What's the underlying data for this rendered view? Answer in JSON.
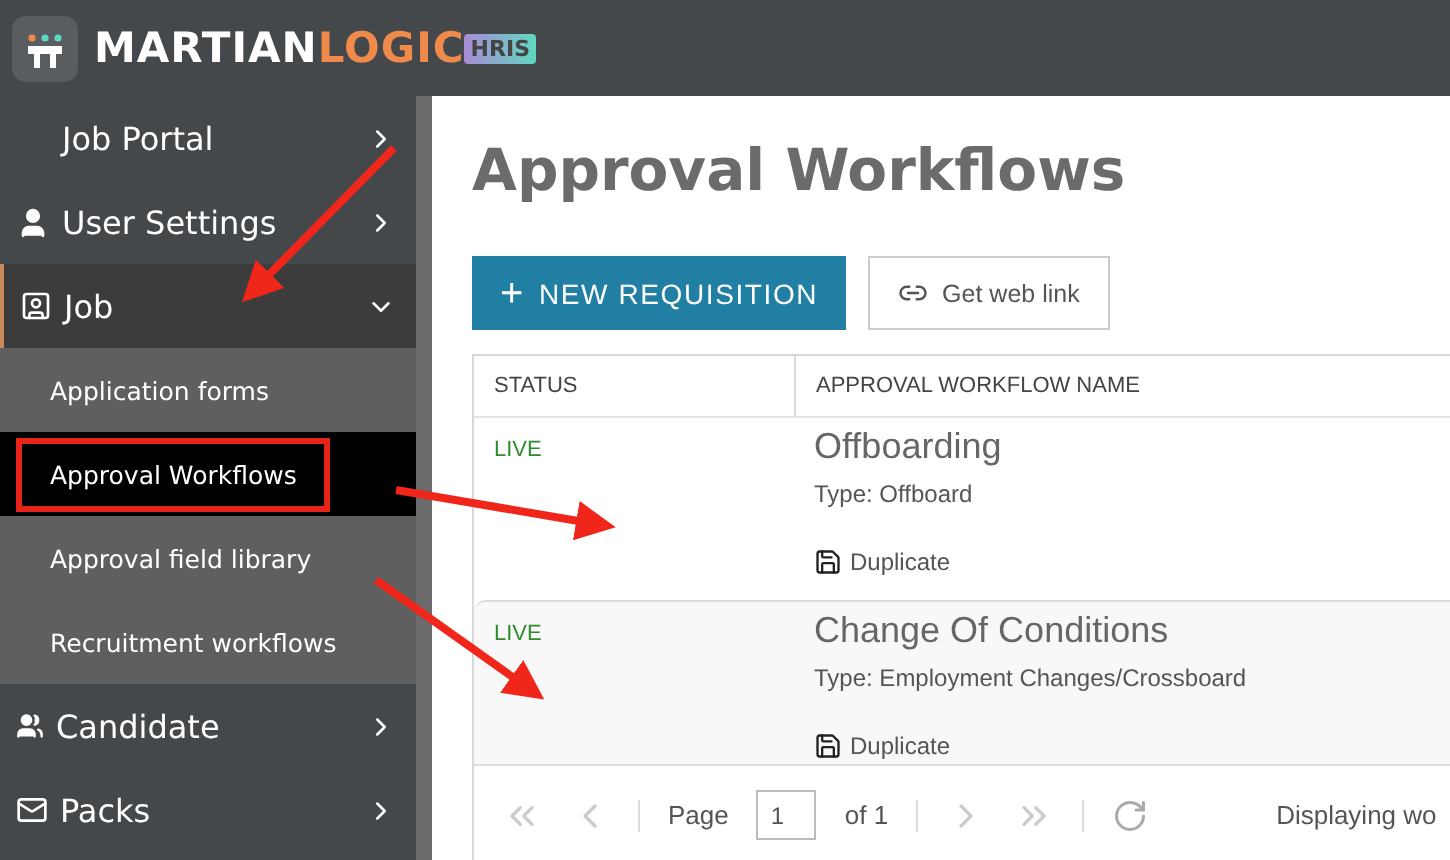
{
  "logo": {
    "word_1": "MARTIAN",
    "word_2": "LOGIC",
    "badge": "HRIS"
  },
  "sidebar": {
    "items": [
      {
        "label": "Job Portal",
        "expanded": false
      },
      {
        "label": "User Settings",
        "expanded": false
      },
      {
        "label": "Job",
        "expanded": true,
        "children": [
          {
            "label": "Application forms",
            "selected": false,
            "annotated": false
          },
          {
            "label": "Approval Workflows",
            "selected": true,
            "annotated": true
          },
          {
            "label": "Approval field library",
            "selected": false,
            "annotated": false
          },
          {
            "label": "Recruitment workflows",
            "selected": false,
            "annotated": false
          }
        ]
      },
      {
        "label": "Candidate",
        "expanded": false
      },
      {
        "label": "Packs",
        "expanded": false
      }
    ]
  },
  "page": {
    "title": "Approval Workflows",
    "buttons": [
      {
        "kind": "primary",
        "icon": "+",
        "label": "NEW REQUISITION"
      },
      {
        "kind": "secondary",
        "label": "Get web link"
      }
    ],
    "table": {
      "columns": [
        "STATUS",
        "APPROVAL WORKFLOW NAME"
      ],
      "rows": [
        {
          "status": "LIVE",
          "name": "Offboarding",
          "type": "Type: Offboard",
          "action": "Duplicate",
          "hovered": false
        },
        {
          "status": "LIVE",
          "name": "Change Of Conditions",
          "type": "Type: Employment Changes/Crossboard",
          "action": "Duplicate",
          "hovered": true
        }
      ]
    },
    "pager": {
      "page_label": "Page",
      "page_value": "1",
      "of_label": "of 1",
      "display_text": "Displaying wo"
    }
  },
  "annotations": [
    {
      "kind": "arrow"
    },
    {
      "kind": "arrow"
    },
    {
      "kind": "arrow"
    }
  ]
}
